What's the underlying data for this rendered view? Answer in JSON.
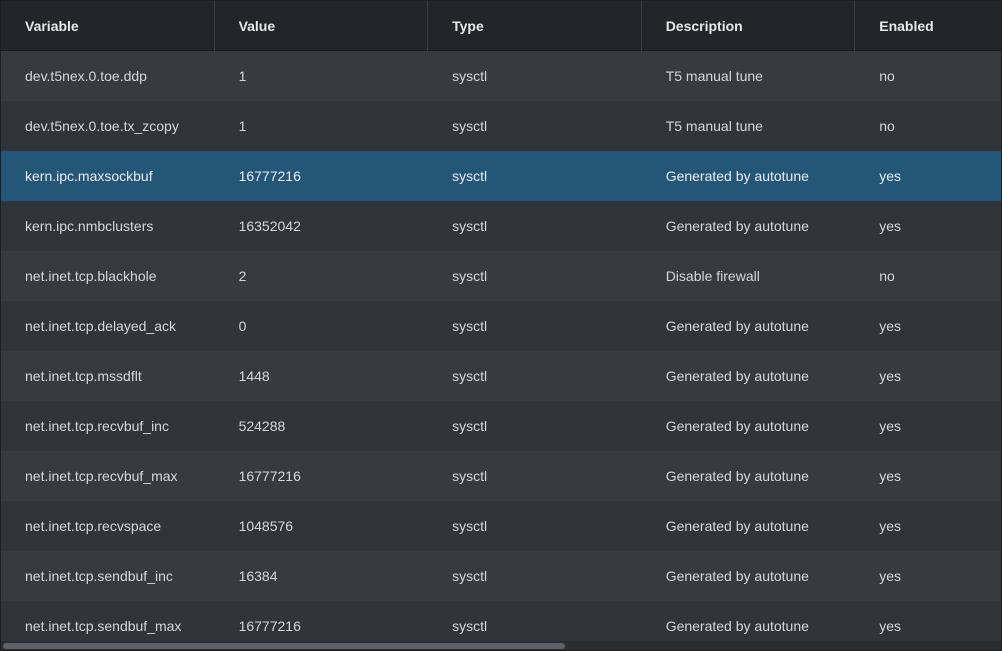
{
  "table": {
    "columns": [
      "Variable",
      "Value",
      "Type",
      "Description",
      "Enabled"
    ],
    "selected_row_index": 2,
    "rows": [
      {
        "variable": "dev.t5nex.0.toe.ddp",
        "value": "1",
        "type": "sysctl",
        "description": "T5 manual tune",
        "enabled": "no"
      },
      {
        "variable": "dev.t5nex.0.toe.tx_zcopy",
        "value": "1",
        "type": "sysctl",
        "description": "T5 manual tune",
        "enabled": "no"
      },
      {
        "variable": "kern.ipc.maxsockbuf",
        "value": "16777216",
        "type": "sysctl",
        "description": "Generated by autotune",
        "enabled": "yes"
      },
      {
        "variable": "kern.ipc.nmbclusters",
        "value": "16352042",
        "type": "sysctl",
        "description": "Generated by autotune",
        "enabled": "yes"
      },
      {
        "variable": "net.inet.tcp.blackhole",
        "value": "2",
        "type": "sysctl",
        "description": "Disable firewall",
        "enabled": "no"
      },
      {
        "variable": "net.inet.tcp.delayed_ack",
        "value": "0",
        "type": "sysctl",
        "description": "Generated by autotune",
        "enabled": "yes"
      },
      {
        "variable": "net.inet.tcp.mssdflt",
        "value": "1448",
        "type": "sysctl",
        "description": "Generated by autotune",
        "enabled": "yes"
      },
      {
        "variable": "net.inet.tcp.recvbuf_inc",
        "value": "524288",
        "type": "sysctl",
        "description": "Generated by autotune",
        "enabled": "yes"
      },
      {
        "variable": "net.inet.tcp.recvbuf_max",
        "value": "16777216",
        "type": "sysctl",
        "description": "Generated by autotune",
        "enabled": "yes"
      },
      {
        "variable": "net.inet.tcp.recvspace",
        "value": "1048576",
        "type": "sysctl",
        "description": "Generated by autotune",
        "enabled": "yes"
      },
      {
        "variable": "net.inet.tcp.sendbuf_inc",
        "value": "16384",
        "type": "sysctl",
        "description": "Generated by autotune",
        "enabled": "yes"
      },
      {
        "variable": "net.inet.tcp.sendbuf_max",
        "value": "16777216",
        "type": "sysctl",
        "description": "Generated by autotune",
        "enabled": "yes"
      }
    ]
  },
  "colors": {
    "header_bg": "#22262a",
    "row_odd": "#373b40",
    "row_even": "#31353a",
    "row_selected": "#245677",
    "text": "#d4d7da"
  }
}
